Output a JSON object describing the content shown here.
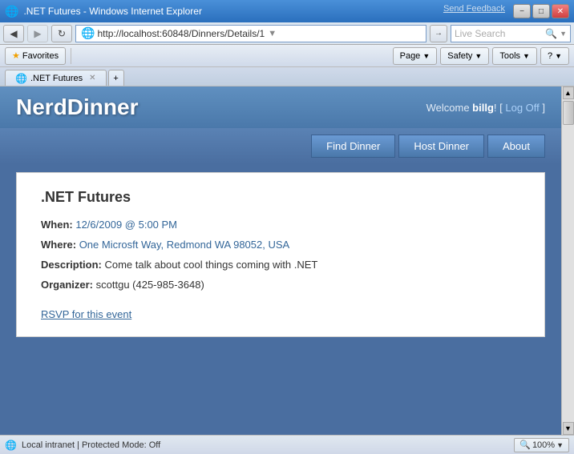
{
  "titleBar": {
    "title": ".NET Futures - Windows Internet Explorer",
    "sendFeedback": "Send Feedback",
    "minBtn": "−",
    "restoreBtn": "□",
    "closeBtn": "✕"
  },
  "addressBar": {
    "url": "http://localhost:60848/Dinners/Details/1",
    "ieIcon": "🌐",
    "refreshIcon": "↻",
    "stopIcon": "✕"
  },
  "searchBar": {
    "placeholder": "Live Search"
  },
  "toolbar": {
    "favorites": "Favorites",
    "addFavorites": "★",
    "pageLabel": "Page",
    "safetyLabel": "Safety",
    "toolsLabel": "Tools",
    "helpIcon": "?"
  },
  "tabs": [
    {
      "label": ".NET Futures",
      "ieIcon": "🌐"
    }
  ],
  "header": {
    "siteTitle": "NerdDinner",
    "welcomeText": "Welcome ",
    "username": "billg",
    "exclamation": "!",
    "logoffPrefix": " [ ",
    "logoffLink": "Log Off",
    "logoffSuffix": " ]"
  },
  "nav": {
    "findDinner": "Find Dinner",
    "hostDinner": "Host Dinner",
    "about": "About"
  },
  "dinner": {
    "title": ".NET Futures",
    "whenLabel": "When:",
    "whenValue": "12/6/2009 @ 5:00 PM",
    "whereLabel": "Where:",
    "whereValue": "One Microsft Way, Redmond WA 98052, USA",
    "descriptionLabel": "Description:",
    "descriptionValue": "Come talk about cool things coming with .NET",
    "organizerLabel": "Organizer:",
    "organizerValue": "scottgu (425-985-3648)",
    "rsvpLink": "RSVP for this event"
  },
  "statusBar": {
    "zoneIcon": "🌐",
    "zoneText": "Local intranet | Protected Mode: Off",
    "zoom": "100%",
    "zoomIcon": "🔍"
  }
}
